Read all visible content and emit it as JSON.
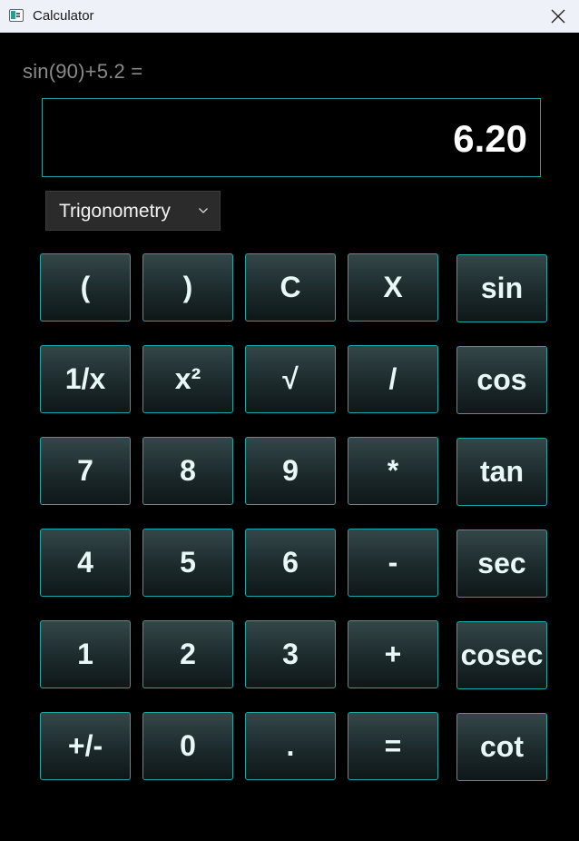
{
  "window": {
    "title": "Calculator"
  },
  "expression": "sin(90)+5.2 =",
  "display": {
    "value": "6.20"
  },
  "mode": {
    "selected": "Trigonometry"
  },
  "keypad": {
    "rows": [
      [
        "(",
        ")",
        "C",
        "X",
        "sin"
      ],
      [
        "1/x",
        "x²",
        "√",
        "/",
        "cos"
      ],
      [
        "7",
        "8",
        "9",
        "*",
        "tan"
      ],
      [
        "4",
        "5",
        "6",
        "-",
        "sec"
      ],
      [
        "1",
        "2",
        "3",
        "+",
        "cosec"
      ],
      [
        "+/-",
        "0",
        ".",
        "=",
        "cot"
      ]
    ]
  },
  "icons": {
    "app": "calculator-app-icon",
    "close": "close-icon",
    "dropdown": "chevron-down-icon"
  },
  "colors": {
    "accent": "#1fa7a5",
    "background": "#000000",
    "titlebar": "#eef2f8"
  }
}
